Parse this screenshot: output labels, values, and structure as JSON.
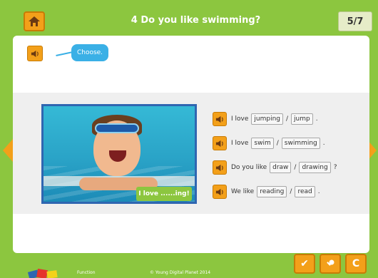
{
  "header": {
    "title": "4 Do you like swimming?",
    "page_indicator": "5/7"
  },
  "instruction": {
    "bubble_text": "Choose."
  },
  "photo": {
    "caption": "I love ......ing!"
  },
  "sentences": [
    {
      "prefix": "I love",
      "option_a": "jumping",
      "option_b": "jump",
      "suffix": "."
    },
    {
      "prefix": "I love",
      "option_a": "swim",
      "option_b": "swimming",
      "suffix": "."
    },
    {
      "prefix": "Do you like",
      "option_a": "draw",
      "option_b": "drawing",
      "suffix": "?"
    },
    {
      "prefix": "We like",
      "option_a": "reading",
      "option_b": "read",
      "suffix": "."
    }
  ],
  "separator": "/",
  "footer": {
    "left_text": "Function",
    "center_text": "© Young Digital Planet 2014"
  },
  "controls": {
    "check_label": "✔",
    "hint_label": "🔑",
    "reset_label": "C"
  },
  "colors": {
    "frame": "#8cc63f",
    "accent": "#f3a01a",
    "bubble": "#3ab0e6",
    "photo_border": "#2f66b1"
  }
}
